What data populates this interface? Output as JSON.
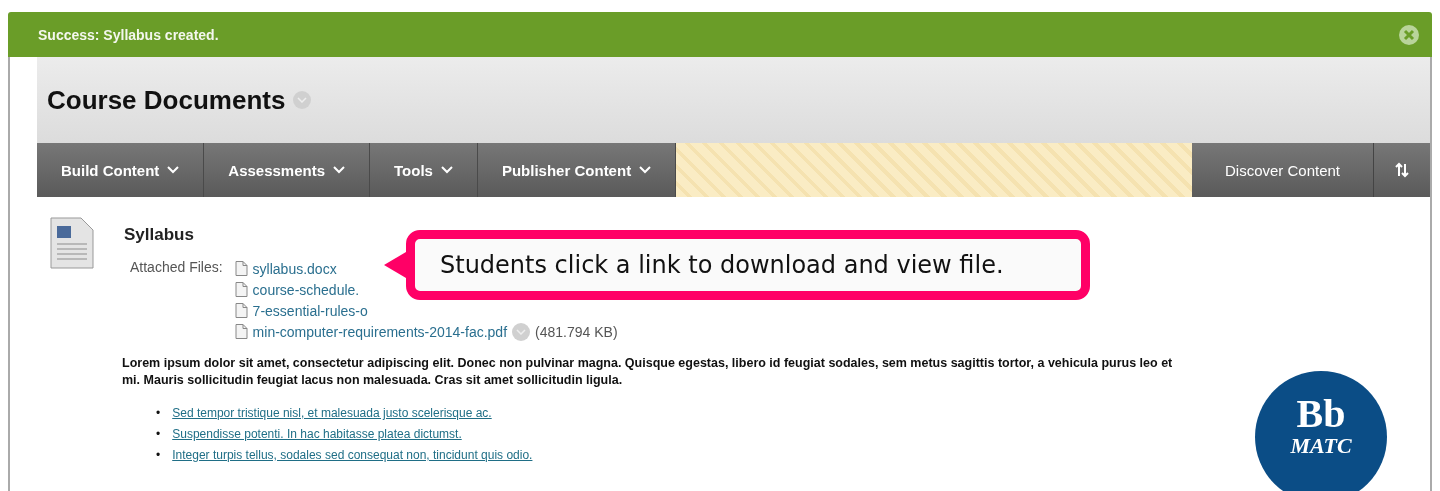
{
  "banner": {
    "message": "Success: Syllabus created."
  },
  "page": {
    "title": "Course Documents"
  },
  "nav": {
    "menus": [
      {
        "label": "Build Content"
      },
      {
        "label": "Assessments"
      },
      {
        "label": "Tools"
      },
      {
        "label": "Publisher Content"
      }
    ],
    "discover": "Discover Content"
  },
  "item": {
    "title": "Syllabus",
    "files_label": "Attached Files:",
    "files": [
      {
        "name": "syllabus.docx"
      },
      {
        "name": "course-schedule."
      },
      {
        "name": "7-essential-rules-o"
      },
      {
        "name": "min-computer-requirements-2014-fac.pdf",
        "size": "(481.794 KB)"
      }
    ],
    "description": "Lorem ipsum dolor sit amet, consectetur adipiscing elit. Donec non pulvinar magna. Quisque egestas, libero id feugiat sodales, sem metus sagittis tortor, a vehicula purus leo et mi. Mauris sollicitudin feugiat lacus non malesuada. Cras sit amet sollicitudin ligula.",
    "links": [
      {
        "bullet": "•",
        "text": "Sed tempor tristique nisl, et malesuada justo scelerisque ac."
      },
      {
        "bullet": "•",
        "text": "Suspendisse potenti. In hac habitasse platea dictumst."
      },
      {
        "bullet": "•",
        "text": "Integer turpis tellus, sodales sed consequat non, tincidunt quis odio."
      }
    ]
  },
  "callout": "Students click a link to download and view file.",
  "logo": {
    "top": "Bb",
    "bottom": "MATC"
  }
}
